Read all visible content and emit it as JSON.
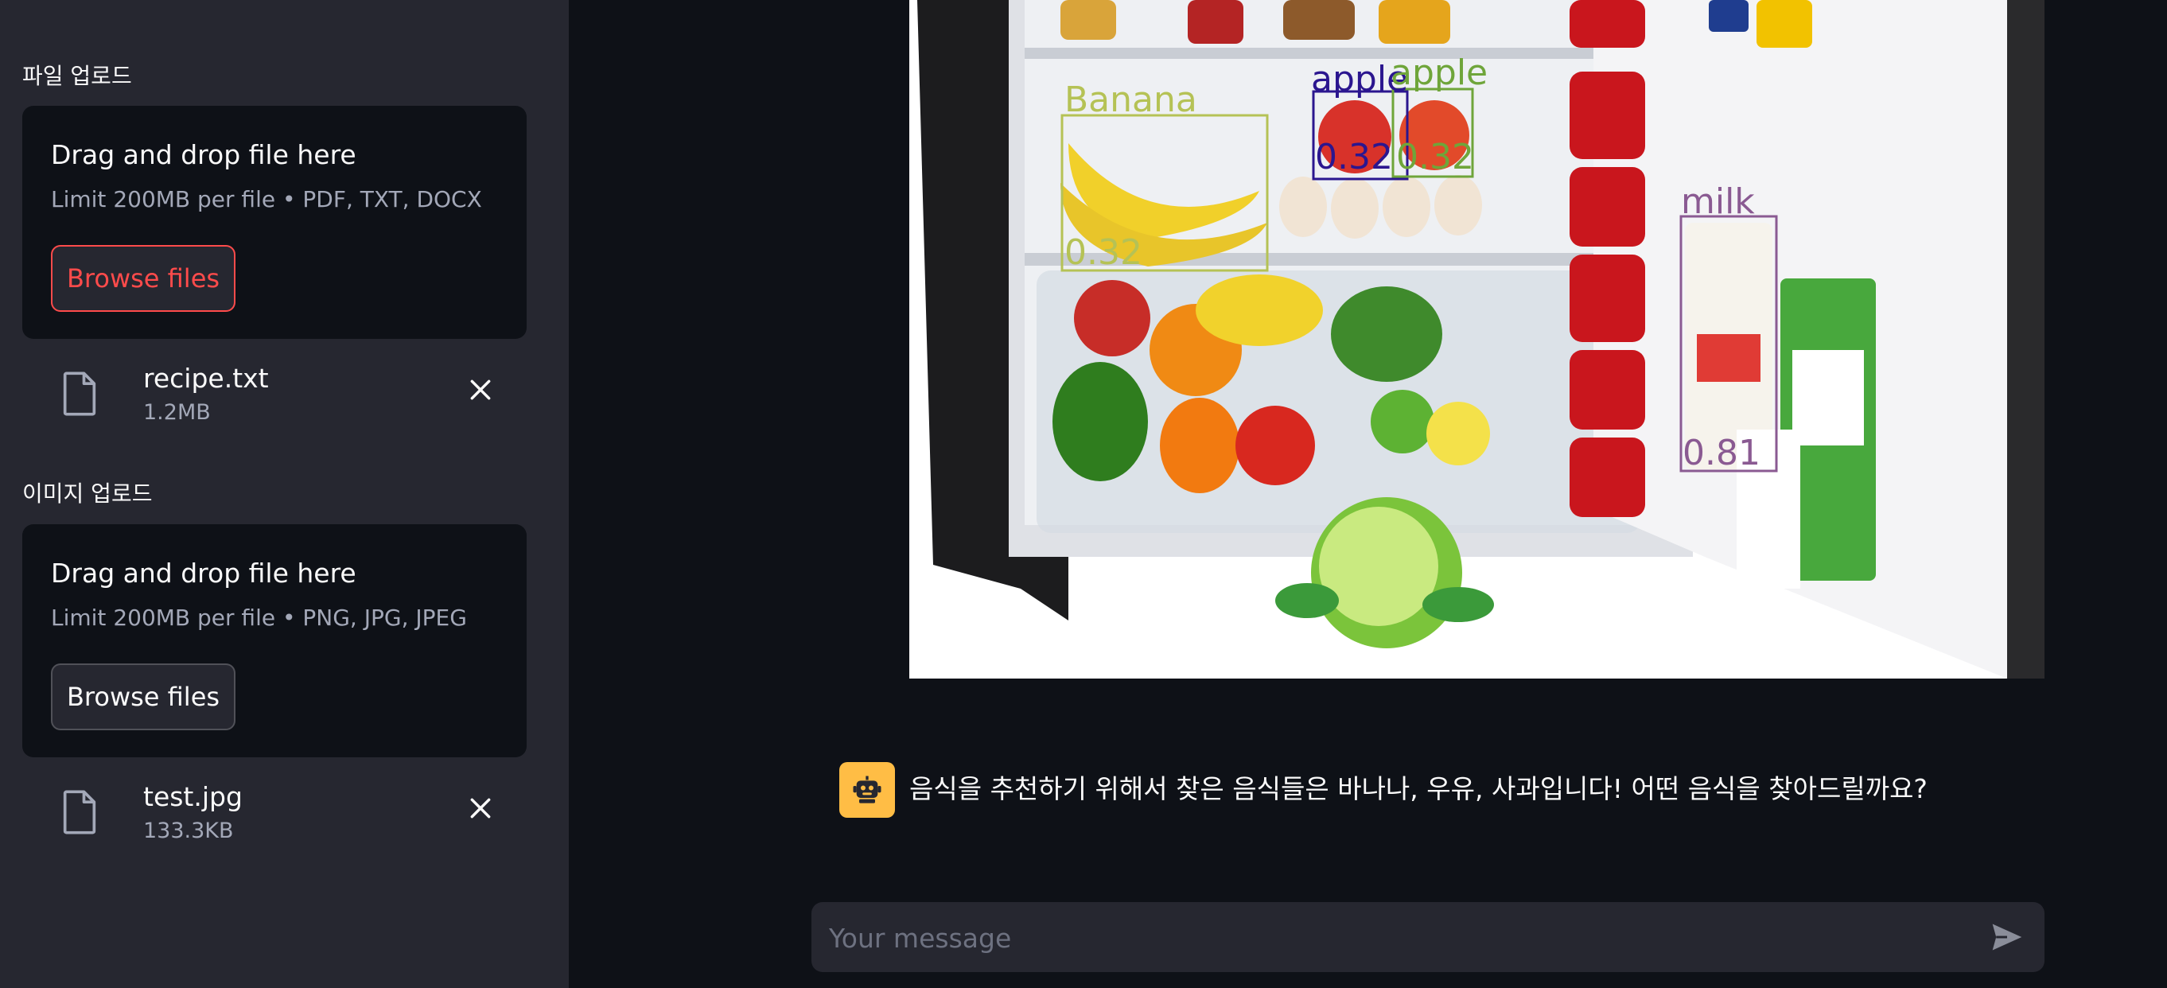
{
  "sidebar": {
    "file_section": {
      "label": "파일 업로드",
      "dropzone_title": "Drag and drop file here",
      "dropzone_limit": "Limit 200MB per file • PDF, TXT, DOCX",
      "browse_label": "Browse files",
      "uploaded_file": {
        "name": "recipe.txt",
        "size": "1.2MB"
      }
    },
    "image_section": {
      "label": "이미지 업로드",
      "dropzone_title": "Drag and drop file here",
      "dropzone_limit": "Limit 200MB per file • PNG, JPG, JPEG",
      "browse_label": "Browse files",
      "uploaded_file": {
        "name": "test.jpg",
        "size": "133.3KB"
      }
    }
  },
  "detection": {
    "boxes": [
      {
        "label": "Banana",
        "score": "0.32",
        "color": "#b5c255"
      },
      {
        "label": "apple",
        "score": "0.32",
        "color": "#2b168f"
      },
      {
        "label": "apple",
        "score": "0.32",
        "color": "#6fa53a"
      },
      {
        "label": "milk",
        "score": "0.81",
        "color": "#8a5a92"
      }
    ]
  },
  "chat": {
    "assistant_message": "음식을 추천하기 위해서 찾은 음식들은 바나나, 우유, 사과입니다! 어떤 음식을 찾아드릴까요?",
    "input_placeholder": "Your message"
  },
  "icons": {
    "file": "file-icon",
    "remove": "close-icon",
    "avatar": "robot-icon",
    "send": "send-icon"
  },
  "colors": {
    "sidebar_bg": "#262730",
    "main_bg": "#0e1117",
    "accent_red": "#ff4b4b",
    "bot_avatar": "#ffbd45"
  }
}
